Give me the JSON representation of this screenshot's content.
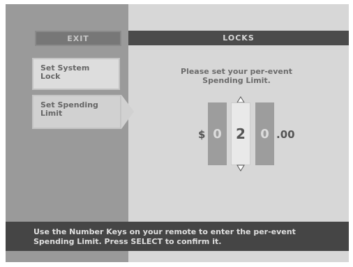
{
  "menu": {
    "exit_label": "EXIT",
    "items": [
      {
        "line1": "Set System",
        "line2": "Lock"
      },
      {
        "line1": "Set Spending",
        "line2": "Limit"
      }
    ]
  },
  "header": {
    "title": "LOCKS"
  },
  "main": {
    "instruction_line1": "Please set your per-event",
    "instruction_line2": "Spending Limit.",
    "currency_symbol": "$",
    "digits": [
      "0",
      "2",
      "0"
    ],
    "decimal_suffix": ".00",
    "up_arrow_icon": "triangle-up",
    "down_arrow_icon": "triangle-down"
  },
  "footer": {
    "line1": "Use the Number Keys on your remote to enter the per-event",
    "line2": "Spending Limit. Press SELECT to confirm it."
  },
  "colors": {
    "left_panel": "#9a9a9a",
    "right_panel": "#d7d7d7",
    "header": "#4b4b4b",
    "footer": "#454545",
    "digit_box": "#9d9d9d",
    "selected_digit_box": "#e9e9e9"
  }
}
